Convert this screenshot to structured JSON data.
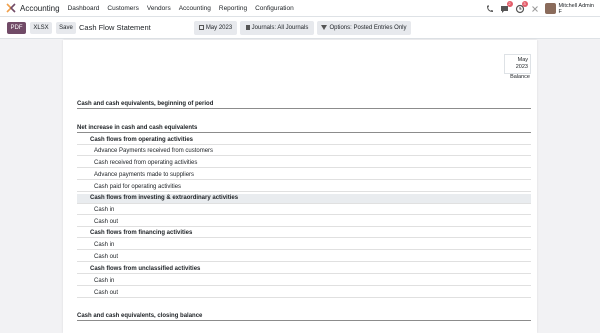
{
  "navbar": {
    "app_name": "Accounting",
    "menu": [
      "Dashboard",
      "Customers",
      "Vendors",
      "Accounting",
      "Reporting",
      "Configuration"
    ],
    "chat_badge": "2",
    "activity_badge": "3",
    "user_name": "Mitchell Admin",
    "user_sub": "F"
  },
  "control": {
    "pdf": "PDF",
    "xlsx": "XLSX",
    "save": "Save",
    "title": "Cash Flow Statement",
    "filter_date": "May 2023",
    "filter_journals": "Journals: All Journals",
    "filter_options": "Options: Posted Entries Only"
  },
  "report": {
    "period_month": "May",
    "period_year": "2023",
    "balance_label": "Balance",
    "rows": [
      "Cash and cash equivalents, beginning of period",
      "Net increase in cash and cash equivalents",
      "Cash flows from operating activities",
      "Advance Payments received from customers",
      "Cash received from operating activities",
      "Advance payments made to suppliers",
      "Cash paid for operating activities",
      "Cash flows from investing & extraordinary activities",
      "Cash in",
      "Cash out",
      "Cash flows from financing activities",
      "Cash in",
      "Cash out",
      "Cash flows from unclassified activities",
      "Cash in",
      "Cash out",
      "Cash and cash equivalents, closing balance"
    ]
  },
  "colors": {
    "brand": "#714b67",
    "badge": "#e35d6a"
  },
  "icons": [
    "accounting-app-icon",
    "phone-icon",
    "chat-icon",
    "activity-icon",
    "close-icon"
  ]
}
